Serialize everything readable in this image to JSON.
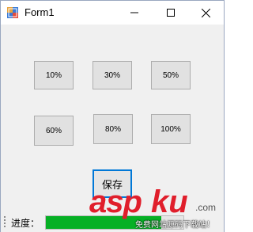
{
  "window": {
    "title": "Form1",
    "controls": {
      "minimize": "minimize-icon",
      "maximize": "maximize-icon",
      "close": "close-icon"
    }
  },
  "buttons": {
    "b10": "10%",
    "b30": "30%",
    "b50": "50%",
    "b60": "60%",
    "b80": "80%",
    "b100": "100%",
    "save": "保存"
  },
  "status": {
    "progress_label": "进度：",
    "progress_percent": 84
  },
  "watermark": {
    "asp": "asp",
    "ku": "ku",
    "com": ".com",
    "sub": "免费网站源码下载站！"
  },
  "colors": {
    "progress_fill": "#06b025",
    "focus_border": "#0078d7",
    "watermark_red": "#e01e2b"
  }
}
